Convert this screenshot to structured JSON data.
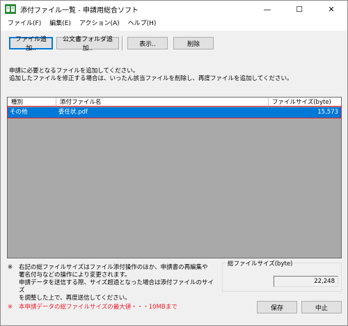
{
  "window": {
    "title": "添付ファイル一覧 - 申請用総合ソフト",
    "controls": {
      "minimize": "—",
      "maximize": "☐",
      "close": "✕"
    }
  },
  "menu": [
    "ファイル(F)",
    "編集(E)",
    "アクション(A)",
    "ヘルプ(H)"
  ],
  "toolbar": {
    "add_file": "ファイル追加..",
    "add_official_folder": "公文書フォルダ追加..",
    "view": "表示..",
    "delete": "削除"
  },
  "instructions": [
    "申請に必要となるファイルを追加してください。",
    "追加したファイルを修正する場合は、いったん該当ファイルを削除し、再度ファイルを追加してください。"
  ],
  "grid": {
    "columns": [
      "種別",
      "添付ファイル名",
      "ファイルサイズ(byte)"
    ],
    "rows": [
      {
        "type": "その他",
        "name": "委任状.pdf",
        "size": "15,573"
      }
    ]
  },
  "notes": {
    "mark": "※",
    "lines": [
      "右記の総ファイルサイズはファイル添付操作のほか、申請書の再編集や",
      "署名付与などの操作により変更されます。",
      "申請データを送信する際、サイズ超過となった場合は添付ファイルのサイズ",
      "を調整した上で、再度送信してください。"
    ],
    "warning": "本申請データの総ファイルサイズの最大値・・・10MBまで"
  },
  "total": {
    "label": "総ファイルサイズ(byte)",
    "value": "22,248"
  },
  "buttons": {
    "save": "保存",
    "cancel": "中止"
  },
  "colors": {
    "selection": "#0078d7",
    "highlight_border": "#e8202a",
    "warning_text": "#e8202a"
  }
}
